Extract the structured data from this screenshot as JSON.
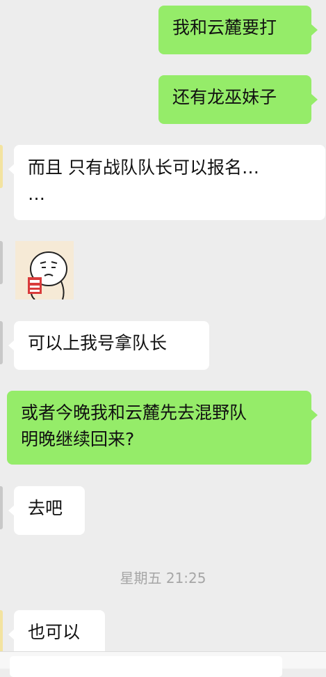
{
  "messages": [
    {
      "type": "text",
      "side": "out",
      "text": "我和云麓要打"
    },
    {
      "type": "text",
      "side": "out",
      "text": "还有龙巫妹子"
    },
    {
      "type": "text",
      "side": "in",
      "lines": [
        "而且   只有战队队长可以报名…",
        "…"
      ]
    },
    {
      "type": "sticker",
      "side": "in",
      "description": "meme-face-sticker"
    },
    {
      "type": "text",
      "side": "in",
      "text": "可以上我号拿队长"
    },
    {
      "type": "text",
      "side": "out",
      "lines": [
        "或者今晚我和云麓先去混野队",
        "明晚继续回来?"
      ]
    },
    {
      "type": "text",
      "side": "in",
      "text": "去吧"
    },
    {
      "type": "timestamp",
      "text": "星期五 21:25"
    },
    {
      "type": "text",
      "side": "in",
      "text": "也可以"
    }
  ],
  "colors": {
    "background": "#ededed",
    "outgoing_bubble": "#95ec69",
    "incoming_bubble": "#ffffff",
    "timestamp_text": "#a6a6a6"
  }
}
